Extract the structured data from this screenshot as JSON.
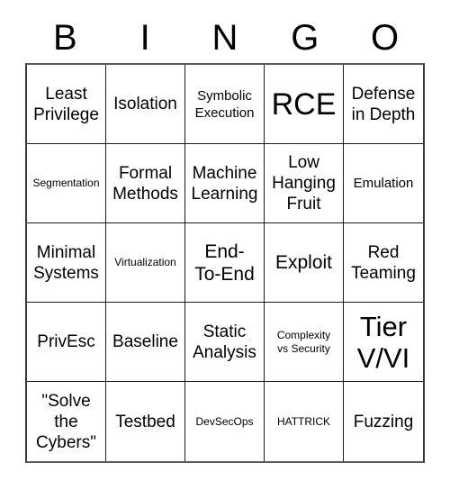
{
  "card": {
    "title_letters": [
      "B",
      "I",
      "N",
      "G",
      "O"
    ],
    "colors": {
      "background": "#ffffff",
      "text": "#000000",
      "grid_line": "#1a1a1a",
      "outer_border": "#5a5a5a"
    },
    "rows": [
      [
        {
          "text": "Least\nPrivilege",
          "size": "sm"
        },
        {
          "text": "Isolation",
          "size": "sm"
        },
        {
          "text": "Symbolic\nExecution",
          "size": "xs"
        },
        {
          "text": "RCE",
          "size": "xl"
        },
        {
          "text": "Defense\nin Depth",
          "size": "sm"
        }
      ],
      [
        {
          "text": "Segmentation",
          "size": "xxs"
        },
        {
          "text": "Formal\nMethods",
          "size": "sm"
        },
        {
          "text": "Machine\nLearning",
          "size": "sm"
        },
        {
          "text": "Low\nHanging\nFruit",
          "size": "sm"
        },
        {
          "text": "Emulation",
          "size": "xs"
        }
      ],
      [
        {
          "text": "Minimal\nSystems",
          "size": "sm"
        },
        {
          "text": "Virtualization",
          "size": "xxs"
        },
        {
          "text": "End-\nTo-End",
          "size": "md"
        },
        {
          "text": "Exploit",
          "size": "md"
        },
        {
          "text": "Red\nTeaming",
          "size": "sm"
        }
      ],
      [
        {
          "text": "PrivEsc",
          "size": "sm"
        },
        {
          "text": "Baseline",
          "size": "sm"
        },
        {
          "text": "Static\nAnalysis",
          "size": "sm"
        },
        {
          "text": "Complexity\nvs Security",
          "size": "xxs"
        },
        {
          "text": "Tier\nV/VI",
          "size": "lg"
        }
      ],
      [
        {
          "text": "\"Solve\nthe\nCybers\"",
          "size": "sm"
        },
        {
          "text": "Testbed",
          "size": "sm"
        },
        {
          "text": "DevSecOps",
          "size": "xxs"
        },
        {
          "text": "HATTRICK",
          "size": "xxs"
        },
        {
          "text": "Fuzzing",
          "size": "sm"
        }
      ]
    ]
  }
}
